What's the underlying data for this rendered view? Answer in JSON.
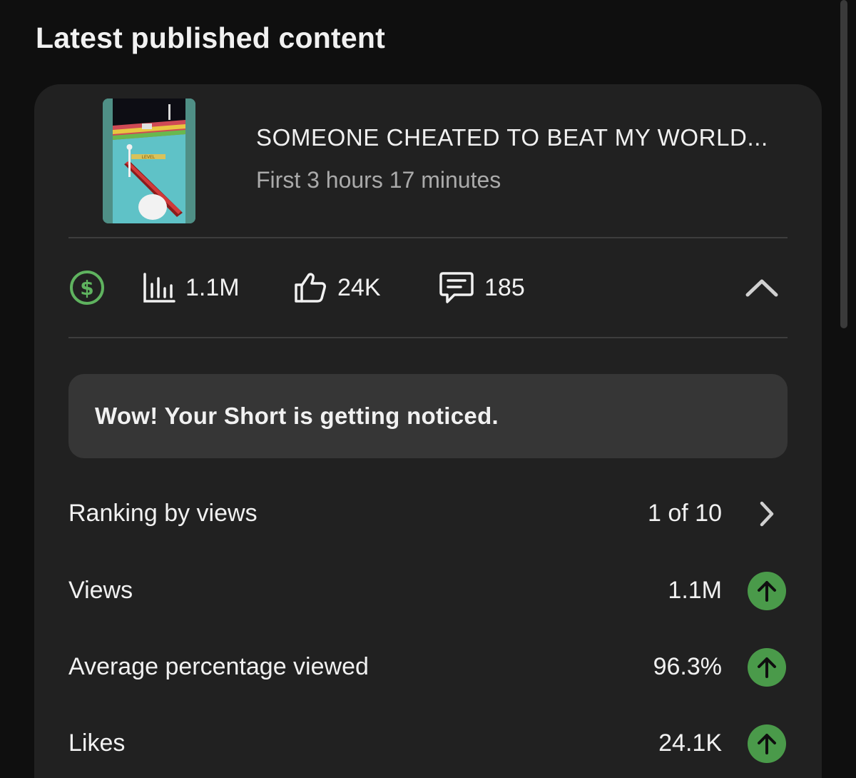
{
  "section": {
    "title": "Latest published content"
  },
  "video": {
    "title": "SOMEONE CHEATED TO BEAT MY WORLD...",
    "subtitle": "First 3 hours 17 minutes",
    "thumbnail_text": "LEVEL"
  },
  "stats": {
    "monetization_icon": "dollar-circle-icon",
    "views": "1.1M",
    "likes": "24K",
    "comments": "185"
  },
  "banner": {
    "text": "Wow! Your Short is getting noticed."
  },
  "metrics": [
    {
      "label": "Ranking by views",
      "value": "1 of 10",
      "indicator": "chevron-right-icon"
    },
    {
      "label": "Views",
      "value": "1.1M",
      "indicator": "arrow-up-icon"
    },
    {
      "label": "Average percentage viewed",
      "value": "96.3%",
      "indicator": "arrow-up-icon"
    },
    {
      "label": "Likes",
      "value": "24.1K",
      "indicator": "arrow-up-icon"
    }
  ],
  "colors": {
    "background": "#0f0f0f",
    "card": "#212121",
    "banner": "#363636",
    "trend_up": "#4a9a4a",
    "monetization": "#5fb35f",
    "secondary_text": "#aaaaaa"
  }
}
